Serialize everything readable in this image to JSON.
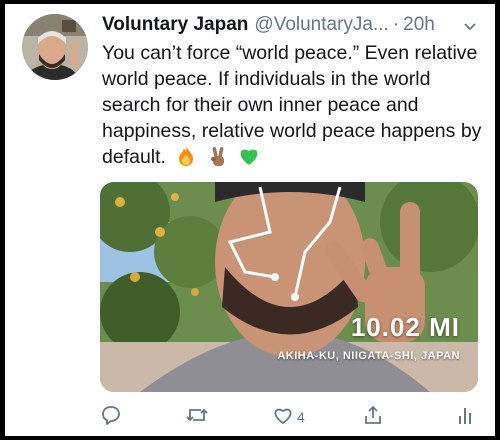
{
  "tweet": {
    "name": "Voluntary Japan",
    "handle": "@VoluntaryJa...",
    "separator": "·",
    "time": "20h",
    "text": "You can’t force “world peace.” Even relative world peace. If individuals in the world search for their own inner peace and happiness, relative world peace happens by default.",
    "emojis": [
      "fire-emoji",
      "victory-hand-emoji",
      "green-heart-emoji"
    ]
  },
  "media": {
    "distance": "10.02 MI",
    "location": "AKIHA-KU, NIIGATA-SHI, JAPAN"
  },
  "actions": {
    "like_count": "4"
  },
  "colors": {
    "text": "#14171a",
    "secondary": "#657786",
    "background": "#ffffff"
  }
}
